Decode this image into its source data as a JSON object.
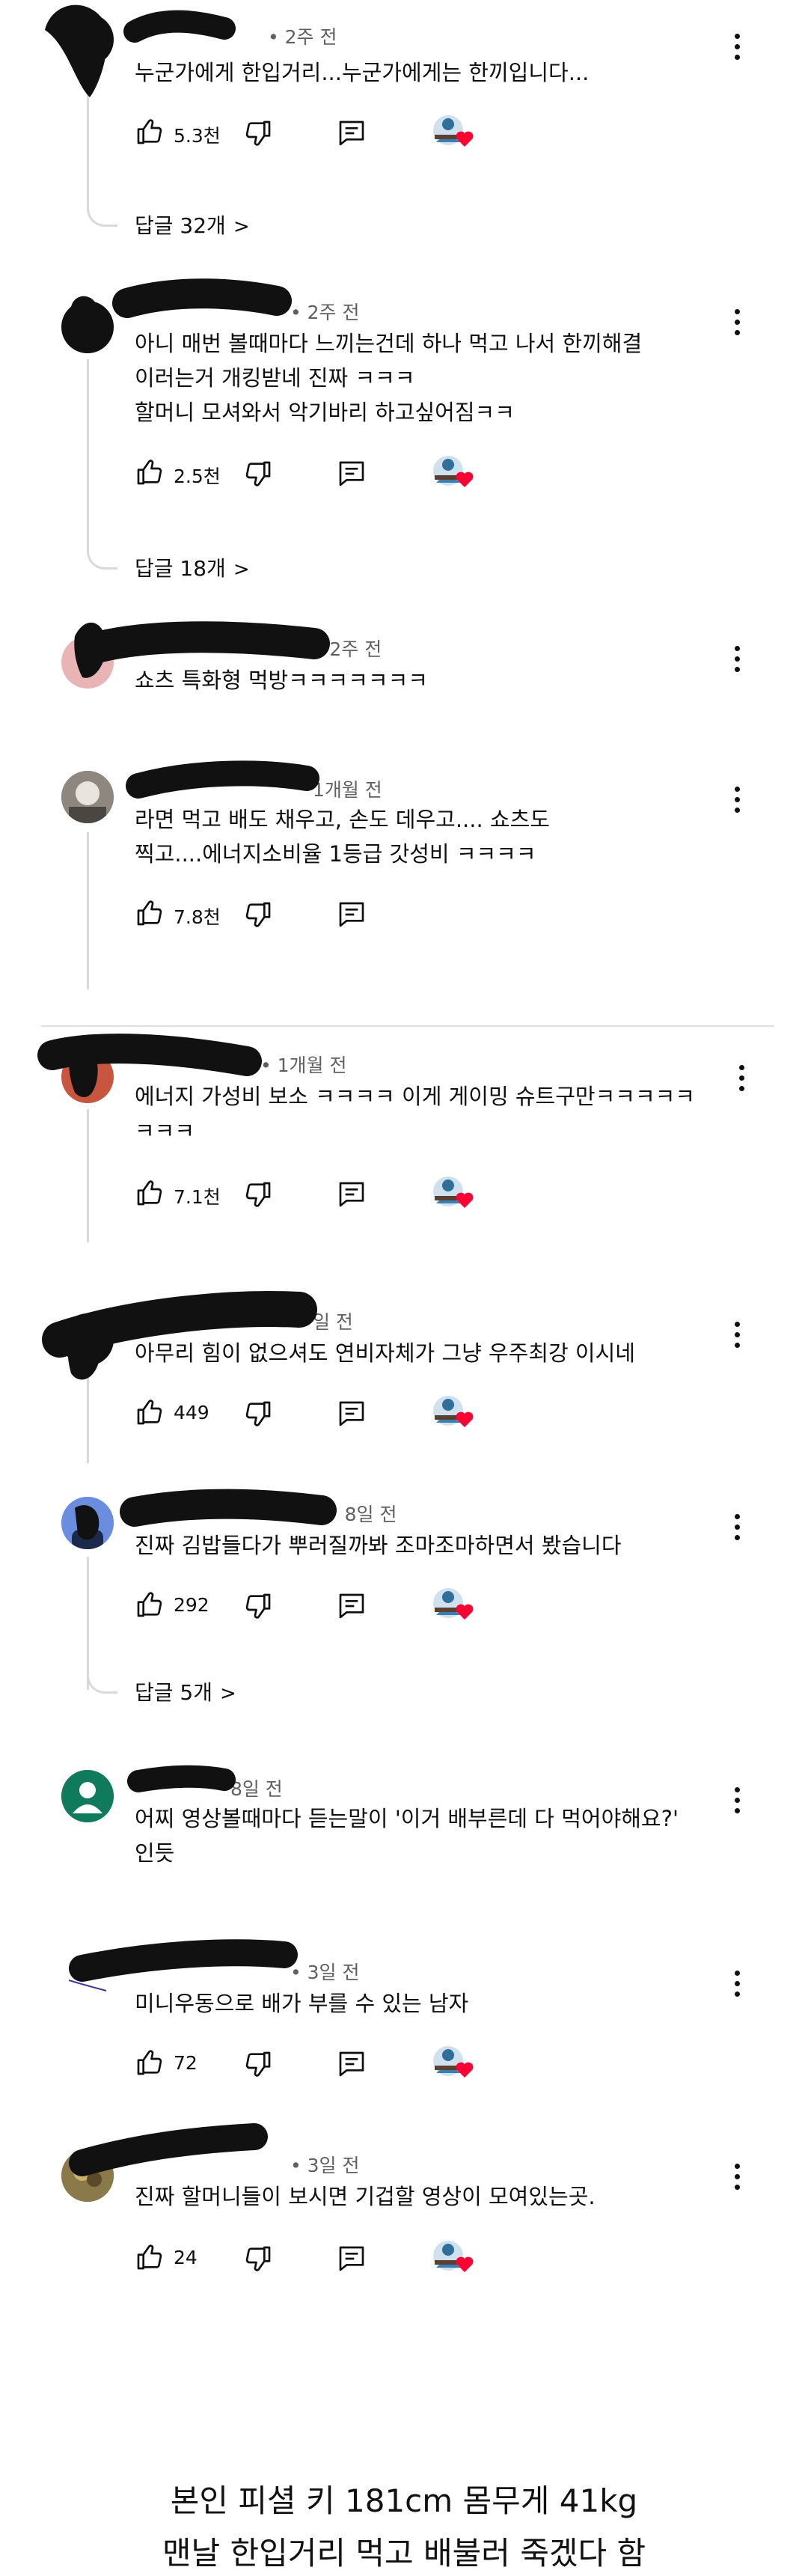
{
  "comments": [
    {
      "time": "• 2주 전",
      "text": "누군가에게 한입거리...누군가에게는 한끼입니다...",
      "likes": "5.3천",
      "replies": "답글 32개"
    },
    {
      "time": "• 2주 전",
      "text": "아니 매번 볼때마다 느끼는건데 하나 먹고 나서 한끼해결\n이러는거 개킹받네 진짜 ㅋㅋㅋ\n할머니 모셔와서 악기바리 하고싶어짐ㅋㅋ",
      "likes": "2.5천",
      "replies": "답글 18개"
    },
    {
      "time": "11 • 2주 전",
      "text": "쇼츠 특화형 먹방ㅋㅋㅋㅋㅋㅋㅋ"
    },
    {
      "time": "1개월 전",
      "text": "라면 먹고 배도 채우고, 손도 데우고.... 쇼츠도\n찍고....에너지소비율 1등급 갓성비 ㅋㅋㅋㅋ",
      "likes": "7.8천"
    },
    {
      "time": "• 1개월 전",
      "text": "에너지 가성비 보소 ㅋㅋㅋㅋ 이게 게이밍 슈트구만ㅋㅋㅋㅋㅋ\nㅋㅋㅋ",
      "likes": "7.1천"
    },
    {
      "time": "일 전",
      "text": "아무리 힘이 없으셔도 연비자체가 그냥 우주최강 이시네",
      "likes": "449"
    },
    {
      "time": "• 8일 전",
      "text": "진짜 김밥들다가 뿌러질까봐 조마조마하면서 봤습니다",
      "likes": "292",
      "replies": "답글 5개"
    },
    {
      "time": "8일 전",
      "text": "어찌 영상볼때마다 듣는말이 '이거 배부른데 다 먹어야해요?'\n인듯"
    },
    {
      "time": "• 3일 전",
      "text": "미니우동으로 배가 부를 수 있는 남자",
      "likes": "72"
    },
    {
      "time": "• 3일 전",
      "text": "진짜 할머니들이 보시면 기겁할 영상이 모여있는곳.",
      "likes": "24"
    }
  ],
  "caption": {
    "line1": "본인 피셜 키 181cm 몸무게 41kg",
    "line2": "맨날 한입거리 먹고 배불러 죽겠다 함"
  },
  "icons": {
    "like": "thumbs-up-icon",
    "dislike": "thumbs-down-icon",
    "reply": "reply-comment-icon",
    "menu": "more-vert-icon",
    "creator_heart": "creator-heart-icon",
    "heart_color": "#ff0033",
    "redaction_color": "#111111"
  }
}
